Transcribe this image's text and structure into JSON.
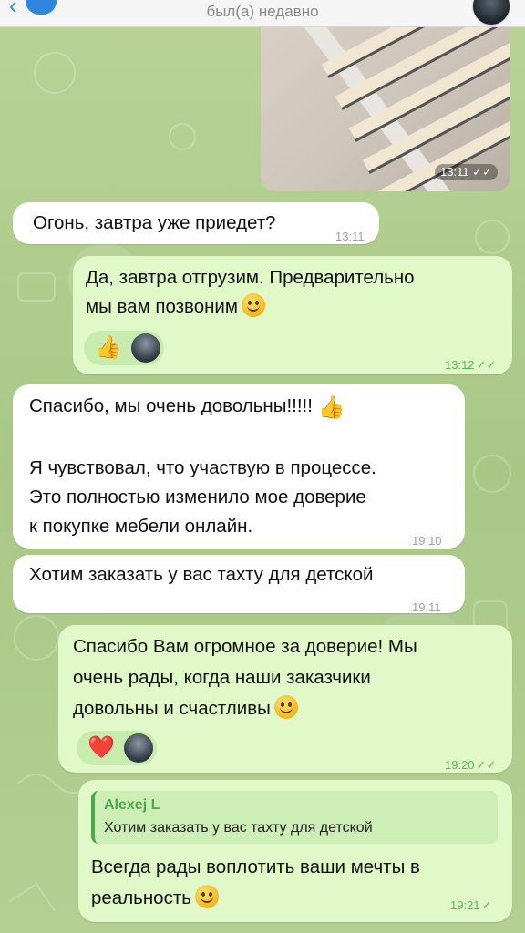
{
  "header": {
    "status": "был(а) недавно"
  },
  "messages": {
    "photo_time": "13:11",
    "m1": {
      "text": "Огонь, завтра уже приедет?",
      "time": "13:11"
    },
    "m2": {
      "line1": "Да, завтра отгрузим. Предварительно",
      "line2": "мы вам позвоним",
      "time": "13:12",
      "reaction": "👍"
    },
    "m3": {
      "line1": "Спасибо, мы очень довольны!!!!!",
      "line2": "Я чувствовал, что участвую в процессе.",
      "line3": "Это полностью изменило мое доверие",
      "line4": "к покупке мебели онлайн.",
      "time": "19:10"
    },
    "m4": {
      "text": "Хотим заказать у вас тахту для детской",
      "time": "19:11"
    },
    "m5": {
      "line1": "Спасибо Вам огромное за доверие! Мы",
      "line2": "очень рады, когда наши заказчики",
      "line3": "довольны и счастливы",
      "time": "19:20",
      "reaction": "❤️"
    },
    "m6": {
      "quote_name": "Alexej L",
      "quote_text": "Хотим заказать у вас тахту для детской",
      "line1": "Всегда рады воплотить ваши мечты в",
      "line2": "реальность",
      "time": "19:21"
    }
  },
  "colors": {
    "incoming": "#ffffff",
    "outgoing": "#e1f8c8",
    "accent_green": "#4ca84b",
    "link_blue": "#2e86de"
  },
  "icons": [
    "back-arrow-icon",
    "double-check-icon",
    "single-check-icon",
    "thumbs-up-icon",
    "heart-icon",
    "smile-icon",
    "wink-icon"
  ]
}
